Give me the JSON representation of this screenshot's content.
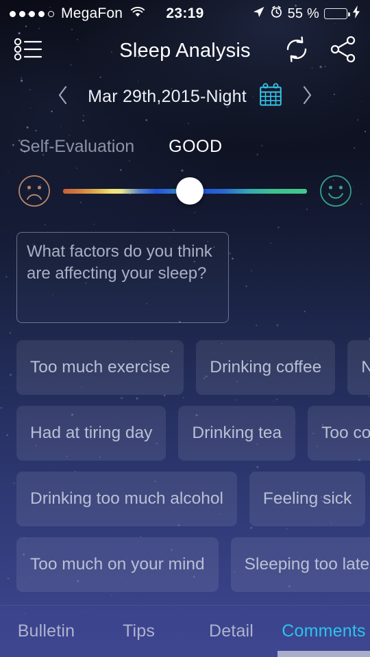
{
  "status_bar": {
    "signal_dots_filled": 4,
    "signal_dots_total": 5,
    "carrier": "MegaFon",
    "wifi_icon": "wifi-icon",
    "time": "23:19",
    "location_icon": "location-arrow-icon",
    "alarm_icon": "alarm-clock-icon",
    "battery_percent": "55 %",
    "battery_fill_ratio": 0.55,
    "charging_icon": "lightning-bolt-icon",
    "battery_color": "#4cd764"
  },
  "navbar": {
    "menu_icon": "list-bullet-icon",
    "title": "Sleep Analysis",
    "refresh_icon": "refresh-icon",
    "share_icon": "share-icon"
  },
  "date_nav": {
    "prev_icon": "chevron-left-icon",
    "label": "Mar 29th,2015-Night",
    "calendar_icon": "calendar-icon",
    "calendar_color": "#35c6e8",
    "next_icon": "chevron-right-icon"
  },
  "self_evaluation": {
    "label": "Self-Evaluation",
    "value": "GOOD",
    "sad_face_icon": "sad-face-icon",
    "happy_face_icon": "happy-face-icon",
    "sad_face_color": "#b5846a",
    "happy_face_color": "#34a08c",
    "slider_position_percent": 52
  },
  "notes": {
    "value": "",
    "placeholder": "What factors do you think are affecting your sleep?"
  },
  "factors": {
    "rows": [
      [
        "Too much exercise",
        "Drinking coffee",
        "Noise"
      ],
      [
        "Had at tiring day",
        "Drinking tea",
        "Too cold"
      ],
      [
        "Drinking too much alcohol",
        "Feeling sick"
      ],
      [
        "Too much on your mind",
        "Sleeping too late"
      ]
    ]
  },
  "tabs": {
    "items": [
      {
        "label": "Bulletin",
        "active": false
      },
      {
        "label": "Tips",
        "active": false
      },
      {
        "label": "Detail",
        "active": false
      },
      {
        "label": "Comments",
        "active": true
      }
    ],
    "active_color": "#2cc2f0",
    "inactive_color": "#aeb3cc"
  }
}
